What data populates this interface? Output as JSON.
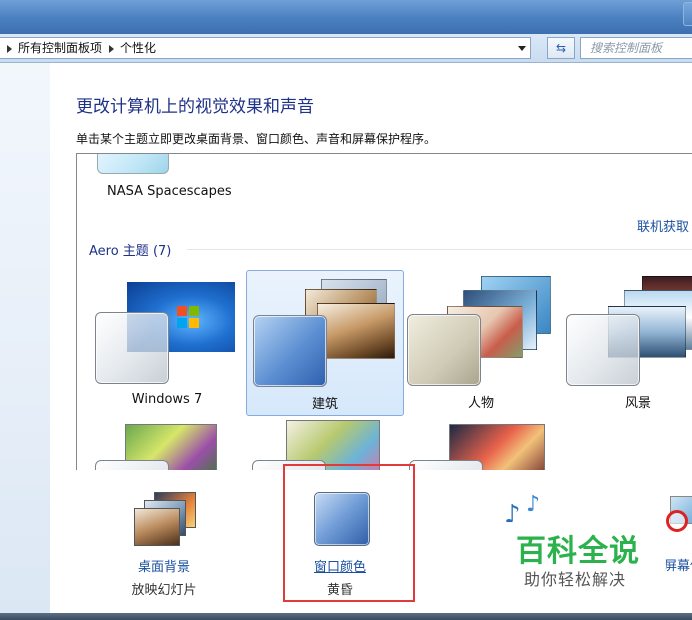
{
  "address": {
    "crumbs": [
      "所有控制面板项",
      "个性化"
    ]
  },
  "search": {
    "placeholder": "搜索控制面板"
  },
  "main": {
    "heading": "更改计算机上的视觉效果和声音",
    "subtext": "单击某个主题立即更改桌面背景、窗口颜色、声音和屏幕保护程序。"
  },
  "themes": {
    "previous_label": "NASA Spacescapes",
    "online_link": "联机获取",
    "group_header": "Aero 主题 (7)",
    "items": [
      {
        "label": "Windows 7",
        "selected": false
      },
      {
        "label": "建筑",
        "selected": true
      },
      {
        "label": "人物",
        "selected": false
      },
      {
        "label": "风景",
        "selected": false
      }
    ]
  },
  "bottom": {
    "desktop_bg": {
      "link": "桌面背景",
      "sub": "放映幻灯片"
    },
    "window_color": {
      "link": "窗口颜色",
      "sub": "黄昏"
    },
    "screensaver": {
      "link": "屏幕保"
    }
  },
  "watermark": {
    "title": "百科全说",
    "subtitle": "助你轻松解决"
  },
  "colors": {
    "accent": "#1a4fa0",
    "highlight_box": "#e23a3a",
    "watermark_green": "#2bb24c"
  }
}
